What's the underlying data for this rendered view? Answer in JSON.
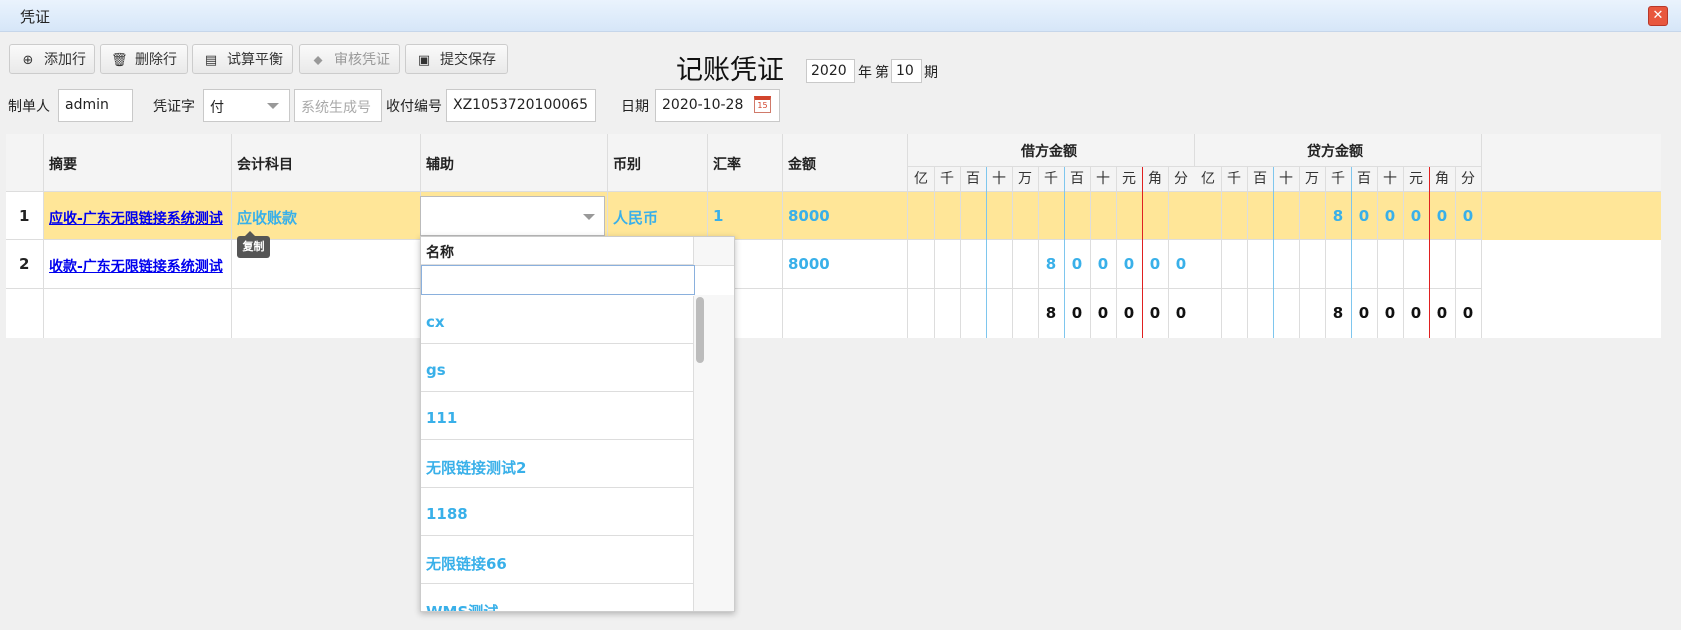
{
  "window": {
    "title": "凭证",
    "close_symbol": "✕"
  },
  "toolbar": {
    "add_row": "添加行",
    "delete_row": "删除行",
    "trial_balance": "试算平衡",
    "audit": "审核凭证",
    "submit_save": "提交保存"
  },
  "voucher": {
    "title": "记账凭证",
    "year": "2020",
    "year_label": "年",
    "period_prefix": "第",
    "period": "10",
    "period_label": "期"
  },
  "form": {
    "maker_label": "制单人",
    "maker": "admin",
    "voucher_word_label": "凭证字",
    "voucher_word": "付",
    "voucher_no_placeholder": "系统生成号",
    "receipt_no_label": "收付编号",
    "receipt_no": "XZ1053720100065",
    "date_label": "日期",
    "date": "2020-10-28",
    "calendar_text": "15"
  },
  "grid": {
    "headers": {
      "summary": "摘要",
      "account": "会计科目",
      "auxiliary": "辅助",
      "currency": "币别",
      "rate": "汇率",
      "amount": "金额",
      "debit": "借方金额",
      "credit": "贷方金额"
    },
    "digit_units": [
      "亿",
      "千",
      "百",
      "十",
      "万",
      "千",
      "百",
      "十",
      "元",
      "角",
      "分"
    ],
    "rows": [
      {
        "num": "1",
        "summary": "应收-广东无限链接系统测试",
        "account": "应收账款",
        "currency": "人民币",
        "rate": "1",
        "amount": "8000",
        "debit_digits": [
          "",
          "",
          "",
          "",
          "",
          "",
          "",
          "",
          "",
          "",
          ""
        ],
        "credit_digits": [
          "",
          "",
          "",
          "",
          "",
          "8",
          "0",
          "0",
          "0",
          "0",
          "0"
        ]
      },
      {
        "num": "2",
        "summary": "收款-广东无限链接系统测试",
        "account": "",
        "currency": "",
        "rate": "",
        "amount": "8000",
        "debit_digits": [
          "",
          "",
          "",
          "",
          "",
          "8",
          "0",
          "0",
          "0",
          "0",
          "0"
        ],
        "credit_digits": [
          "",
          "",
          "",
          "",
          "",
          "",
          "",
          "",
          "",
          "",
          ""
        ]
      }
    ],
    "totals": {
      "debit_digits": [
        "",
        "",
        "",
        "",
        "",
        "8",
        "0",
        "0",
        "0",
        "0",
        "0"
      ],
      "credit_digits": [
        "",
        "",
        "",
        "",
        "",
        "8",
        "0",
        "0",
        "0",
        "0",
        "0"
      ]
    }
  },
  "tooltip": {
    "text": "复制"
  },
  "dropdown": {
    "header": "名称",
    "filter_value": "",
    "items": [
      "cx",
      "gs",
      "111",
      "无限链接测试2",
      "1188",
      "无限链接66",
      "WMS测试"
    ]
  },
  "icons": {
    "add": "plus-circle-icon",
    "delete": "trash-icon",
    "balance": "calculator-icon",
    "audit": "tag-icon",
    "save": "floppy-disk-icon",
    "calendar": "calendar-icon",
    "close": "close-icon"
  },
  "colors": {
    "selected_row": "#ffe698",
    "value_blue": "#39b0e9",
    "link": "#0000ee",
    "yuan_separator": "#e02020",
    "thousand_separator": "#7ec6ee"
  }
}
